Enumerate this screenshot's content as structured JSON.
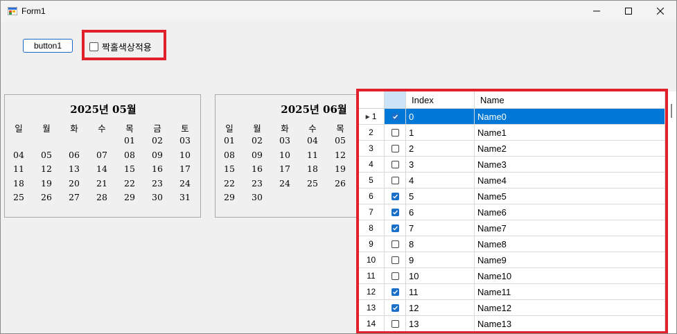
{
  "window": {
    "title": "Form1"
  },
  "toolbar": {
    "button1_label": "button1",
    "checkbox_label": "짝홀색상적용"
  },
  "calendars": [
    {
      "title": "2025년  05월",
      "weekdays": [
        "일",
        "월",
        "화",
        "수",
        "목",
        "금",
        "토"
      ],
      "rows": [
        [
          "",
          "",
          "",
          "",
          "01",
          "02",
          "03"
        ],
        [
          "04",
          "05",
          "06",
          "07",
          "08",
          "09",
          "10"
        ],
        [
          "11",
          "12",
          "13",
          "14",
          "15",
          "16",
          "17"
        ],
        [
          "18",
          "19",
          "20",
          "21",
          "22",
          "23",
          "24"
        ],
        [
          "25",
          "26",
          "27",
          "28",
          "29",
          "30",
          "31"
        ]
      ]
    },
    {
      "title": "2025년  06월",
      "weekdays": [
        "일",
        "월",
        "화",
        "수",
        "목"
      ],
      "rows": [
        [
          "01",
          "02",
          "03",
          "04",
          "05"
        ],
        [
          "08",
          "09",
          "10",
          "11",
          "12"
        ],
        [
          "15",
          "16",
          "17",
          "18",
          "19"
        ],
        [
          "22",
          "23",
          "24",
          "25",
          "26"
        ],
        [
          "29",
          "30",
          "",
          "",
          ""
        ]
      ]
    }
  ],
  "grid": {
    "columns": [
      "Index",
      "Name"
    ],
    "rows": [
      {
        "n": "1",
        "checked": true,
        "index": "0",
        "name": "Name0"
      },
      {
        "n": "2",
        "checked": false,
        "index": "1",
        "name": "Name1"
      },
      {
        "n": "3",
        "checked": false,
        "index": "2",
        "name": "Name2"
      },
      {
        "n": "4",
        "checked": false,
        "index": "3",
        "name": "Name3"
      },
      {
        "n": "5",
        "checked": false,
        "index": "4",
        "name": "Name4"
      },
      {
        "n": "6",
        "checked": true,
        "index": "5",
        "name": "Name5"
      },
      {
        "n": "7",
        "checked": true,
        "index": "6",
        "name": "Name6"
      },
      {
        "n": "8",
        "checked": true,
        "index": "7",
        "name": "Name7"
      },
      {
        "n": "9",
        "checked": false,
        "index": "8",
        "name": "Name8"
      },
      {
        "n": "10",
        "checked": false,
        "index": "9",
        "name": "Name9"
      },
      {
        "n": "11",
        "checked": false,
        "index": "10",
        "name": "Name10"
      },
      {
        "n": "12",
        "checked": true,
        "index": "11",
        "name": "Name11"
      },
      {
        "n": "13",
        "checked": true,
        "index": "12",
        "name": "Name12"
      },
      {
        "n": "14",
        "checked": false,
        "index": "13",
        "name": "Name13"
      }
    ],
    "selected_row": 0,
    "highlight_color": "#0078d7",
    "check_color": "#1a6fc9"
  },
  "annotation_color": "#e0202a"
}
